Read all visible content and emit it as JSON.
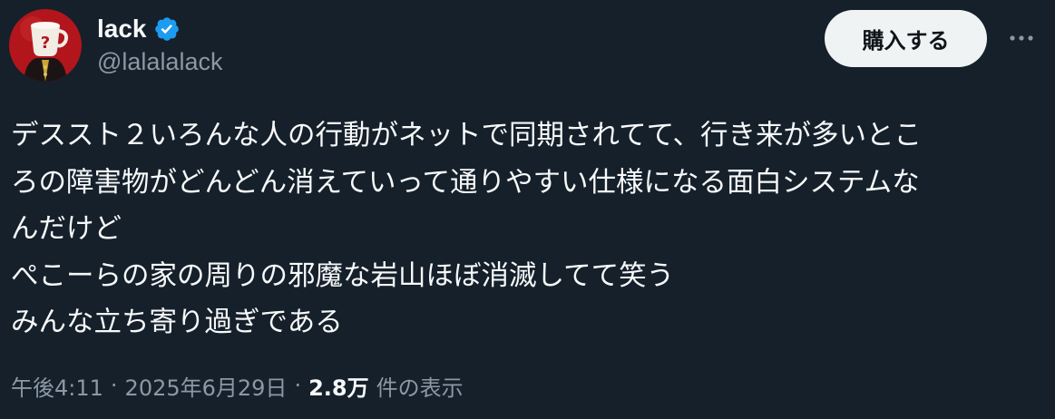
{
  "author": {
    "display_name": "lack",
    "handle": "@lalalalack",
    "verified": true,
    "verified_color": "#1d9bf0"
  },
  "header": {
    "buy_button_label": "購入する",
    "more_icon": "more-horizontal-icon"
  },
  "tweet": {
    "lines": [
      "デススト２いろんな人の行動がネットで同期されてて、行き来が多いとこ",
      "ろの障害物がどんどん消えていって通りやすい仕様になる面白システムな",
      "んだけど",
      "ぺこーらの家の周りの邪魔な岩山ほぼ消滅してて笑う",
      "みんな立ち寄り過ぎである"
    ]
  },
  "meta": {
    "time": "午後4:11",
    "separator": "·",
    "date": "2025年6月29日",
    "views_count": "2.8万",
    "views_label": "件の表示"
  },
  "colors": {
    "background": "#15202b",
    "text_primary": "#f7f9f9",
    "text_secondary": "#8b98a5",
    "button_bg": "#eff3f4",
    "button_text": "#0f1419"
  }
}
